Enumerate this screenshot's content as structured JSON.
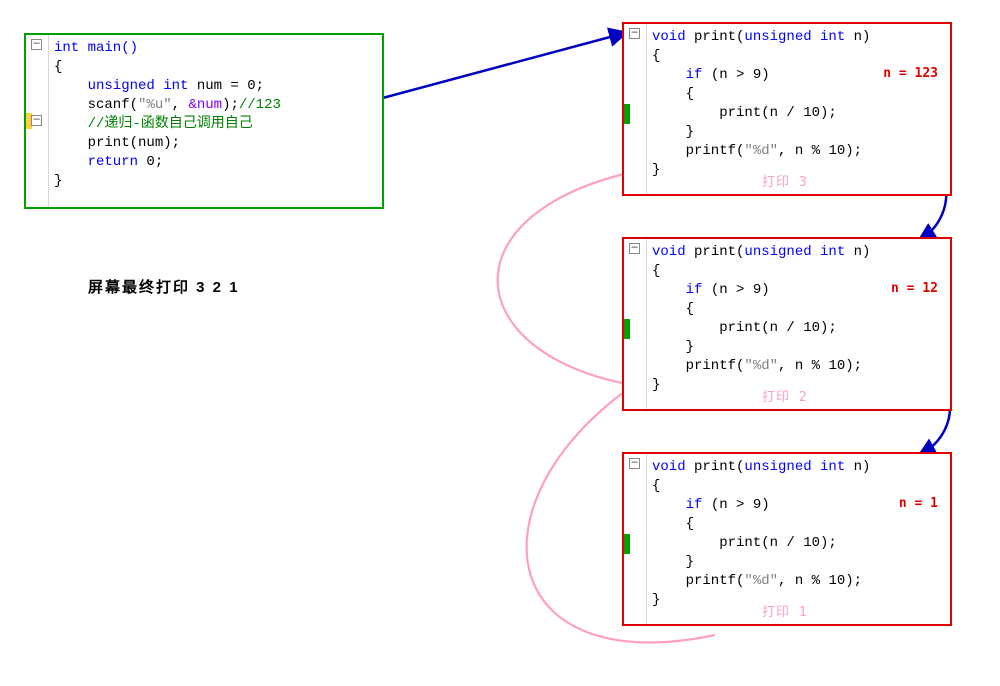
{
  "main_box": {
    "line1": "int main()",
    "line2": "{",
    "line3": "    unsigned int num = 0;",
    "l3_kw": "    unsigned int",
    "l3_rest": " num = 0;",
    "line4": "    scanf(\"%u\", &num);//123",
    "l4_name": "    scanf",
    "l4_str": "\"%u\"",
    "l4_mid": ", ",
    "l4_arg": "&num",
    "l4_end": ");",
    "l4_cmt": "//123",
    "line5": "    //递归-函数自己调用自己",
    "line6_a": "    print",
    "line6_b": "(num);",
    "line7_kw": "    return",
    "line7_rest": " 0;",
    "line8": "}"
  },
  "print_box": {
    "l1_a": "void",
    "l1_b": " print(",
    "l1_c": "unsigned int",
    "l1_d": " n)",
    "l2": "{",
    "l3_a": "    if",
    "l3_b": " (n > 9)",
    "l4": "    {",
    "l5": "        print(n / 10);",
    "l6": "    }",
    "l7_a": "    printf(",
    "l7_b": "\"%d\"",
    "l7_c": ", n % 10);",
    "l8": "}"
  },
  "annot": {
    "n123": "n = 123",
    "n12": "n = 12",
    "n1": "n = 1"
  },
  "pink": {
    "p3": "打印 3",
    "p2": "打印 2",
    "p1": "打印 1"
  },
  "summary": "屏幕最终打印 3 2 1"
}
